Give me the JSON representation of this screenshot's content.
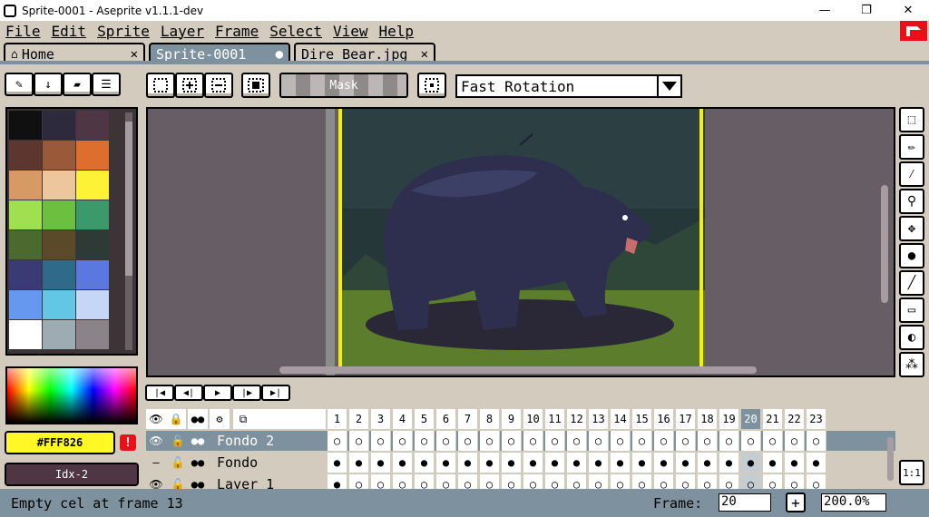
{
  "window": {
    "title": "Sprite-0001 - Aseprite v1.1.1-dev",
    "minimize": "—",
    "maximize": "❐",
    "close": "✕"
  },
  "menu": {
    "items": [
      "File",
      "Edit",
      "Sprite",
      "Layer",
      "Frame",
      "Select",
      "View",
      "Help"
    ]
  },
  "tabs": [
    {
      "label": "Home",
      "icon": "home-icon",
      "close": "✕"
    },
    {
      "label": "Sprite-0001",
      "modified_marker": "●"
    },
    {
      "label": "Dire Bear.jpg",
      "close": "✕"
    }
  ],
  "context_bar": {
    "mask_label": "Mask",
    "rotation_algorithm": "Fast Rotation",
    "dropdown_icon": "triangle-down-icon"
  },
  "palette": {
    "colors": [
      "#101010",
      "#2e2a3d",
      "#4e3644",
      "#5e3630",
      "#9a5a3a",
      "#de6e2e",
      "#d89a64",
      "#eec69e",
      "#fdf236",
      "#a0e050",
      "#6cc040",
      "#3c9a6a",
      "#4a6a30",
      "#5a4a2a",
      "#2e3a36",
      "#3a3a74",
      "#2e6a8a",
      "#5a78e0",
      "#6698f0",
      "#62c6e4",
      "#c6d6f6",
      "#ffffff",
      "#9cacb2",
      "#8a8488"
    ]
  },
  "colors": {
    "foreground": "#FFF826",
    "foreground_label": "#FFF826",
    "background_label": "Idx-2",
    "warning": "!"
  },
  "tools": [
    "marquee-icon",
    "pencil-icon",
    "eyedropper-icon",
    "zoom-icon",
    "move-icon",
    "fill-icon",
    "line-icon",
    "rectangle-icon",
    "contour-icon",
    "spray-icon"
  ],
  "timeline": {
    "frames": [
      "1",
      "2",
      "3",
      "4",
      "5",
      "6",
      "7",
      "8",
      "9",
      "10",
      "11",
      "12",
      "13",
      "14",
      "15",
      "16",
      "17",
      "18",
      "19",
      "20",
      "21",
      "22",
      "23"
    ],
    "current_frame": "20",
    "layers": [
      {
        "name": "Fondo 2"
      },
      {
        "name": "Fondo"
      },
      {
        "name": "Layer 1"
      }
    ]
  },
  "status": {
    "text": "Empty cel at frame 13",
    "frame_label": "Frame:",
    "frame_value": "20",
    "zoom_value": "200.0%",
    "plus": "+",
    "zoom_one": "1:1"
  }
}
